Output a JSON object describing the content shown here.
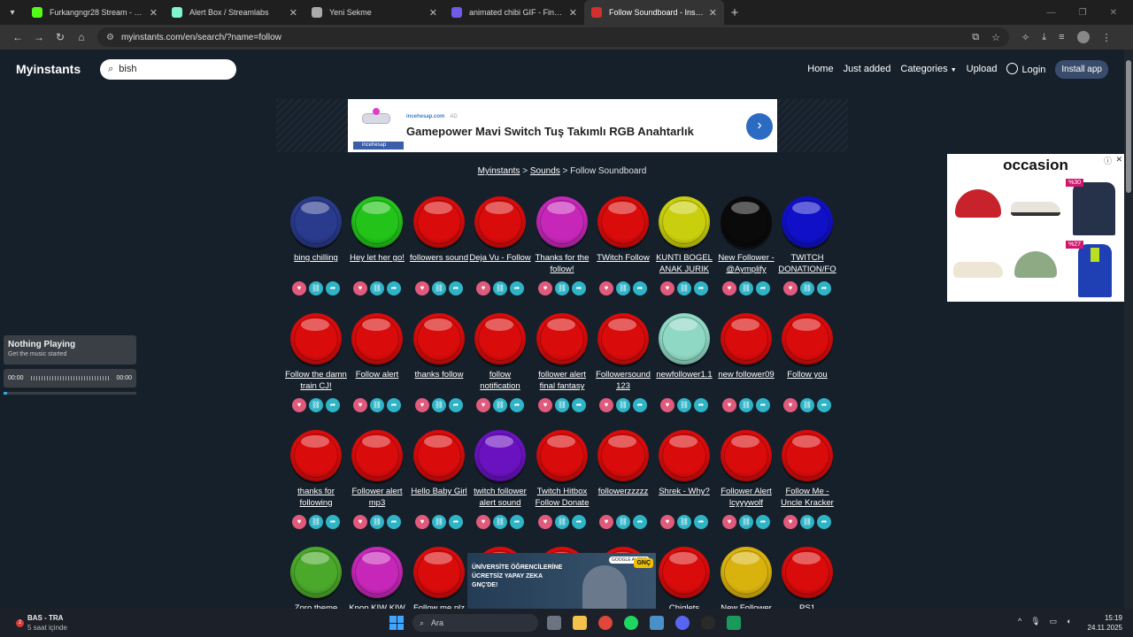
{
  "browser": {
    "tabs": [
      {
        "title": "Furkangngr28 Stream - Watch L",
        "color": "#53fc18",
        "active": false
      },
      {
        "title": "Alert Box / Streamlabs",
        "color": "#80f5d2",
        "active": false
      },
      {
        "title": "Yeni Sekme",
        "color": "#aaaaaa",
        "active": false
      },
      {
        "title": "animated chibi GIF - Find & Sha",
        "color": "#6c5ce7",
        "active": false
      },
      {
        "title": "Follow Soundboard - Instant So",
        "color": "#d32f2f",
        "active": true
      }
    ],
    "new_tab": "+",
    "url": "myinstants.com/en/search/?name=follow"
  },
  "site": {
    "logo": "Myinstants",
    "search_value": "bish",
    "nav": {
      "home": "Home",
      "just_added": "Just added",
      "categories": "Categories",
      "upload": "Upload",
      "login": "Login",
      "install": "Install app"
    }
  },
  "ad_banner": {
    "source": "incehesap.com",
    "ad_label": "AD",
    "title": "Gamepower Mavi Switch Tuş Takımlı RGB Anahtarlık",
    "brand": "incehesap"
  },
  "side_ad": {
    "title": "occasion",
    "badge1": "%30",
    "badge2": "%27"
  },
  "breadcrumb": {
    "root": "Myinstants",
    "sounds": "Sounds",
    "current": "Follow Soundboard"
  },
  "sounds": [
    {
      "name": "bing chilling",
      "color": "#2a3a8c"
    },
    {
      "name": "Hey let her go!",
      "color": "#22c41a"
    },
    {
      "name": "followers sound",
      "color": "#d90b0b"
    },
    {
      "name": "Deja Vu - Follow",
      "color": "#d90b0b"
    },
    {
      "name": "Thanks for the follow!",
      "color": "#c627b8"
    },
    {
      "name": "TWitch Follow",
      "color": "#d90b0b"
    },
    {
      "name": "KUNTI BOGEL ANAK JURIK",
      "color": "#c9cf0d"
    },
    {
      "name": "New Follower - @Aymplify",
      "color": "#0a0a0a"
    },
    {
      "name": "TWITCH DONATION/FO",
      "color": "#1010c8"
    },
    {
      "name": "Follow the damn train CJ!",
      "color": "#d90b0b"
    },
    {
      "name": "Follow alert",
      "color": "#d90b0b"
    },
    {
      "name": "thanks follow",
      "color": "#d90b0b"
    },
    {
      "name": "follow notification",
      "color": "#d90b0b"
    },
    {
      "name": "follower alert final fantasy",
      "color": "#d90b0b"
    },
    {
      "name": "Followersound 123",
      "color": "#d90b0b"
    },
    {
      "name": "newfollower1.1",
      "color": "#8fd8c4"
    },
    {
      "name": "new follower09",
      "color": "#d90b0b"
    },
    {
      "name": "Follow you",
      "color": "#d90b0b"
    },
    {
      "name": "thanks for following",
      "color": "#d90b0b"
    },
    {
      "name": "Follower alert mp3",
      "color": "#d90b0b"
    },
    {
      "name": "Hello Baby Girl",
      "color": "#d90b0b"
    },
    {
      "name": "twitch follower alert sound",
      "color": "#6a12c0"
    },
    {
      "name": "Twitch Hitbox Follow Donate",
      "color": "#d90b0b"
    },
    {
      "name": "followerzzzzz",
      "color": "#d90b0b"
    },
    {
      "name": "Shrek - Why?",
      "color": "#d90b0b"
    },
    {
      "name": "Follower Alert lcyyywolf",
      "color": "#d90b0b"
    },
    {
      "name": "Follow Me - Uncle Kracker",
      "color": "#d90b0b"
    },
    {
      "name": "Zoro theme",
      "color": "#4aa82a"
    },
    {
      "name": "Knop KIW KIW",
      "color": "#c627b8"
    },
    {
      "name": "Follow me plz",
      "color": "#d90b0b"
    },
    {
      "name": "",
      "color": "#d90b0b"
    },
    {
      "name": "",
      "color": "#d90b0b"
    },
    {
      "name": "",
      "color": "#d90b0b"
    },
    {
      "name": "Chiglets",
      "color": "#d90b0b"
    },
    {
      "name": "New Follower",
      "color": "#d9b20d"
    },
    {
      "name": "PS1",
      "color": "#d90b0b"
    }
  ],
  "player": {
    "title": "Nothing Playing",
    "subtitle": "Get the music started",
    "time_start": "00:00",
    "time_end": "00:00",
    "progress": 0
  },
  "bottom_ad": {
    "text": "ÜNİVERSİTE ÖĞRENCİLERİNE ÜCRETSİZ YAPAY ZEKA GNÇ'DE!",
    "badge": "GNÇ",
    "pill": "GOOGLE AI PRO"
  },
  "taskbar": {
    "weather_badge": "2",
    "weather_title": "BAS - TRA",
    "weather_sub": "5 saat içinde",
    "search": "Ara",
    "time": "15:19",
    "date": "24.11.2025"
  }
}
